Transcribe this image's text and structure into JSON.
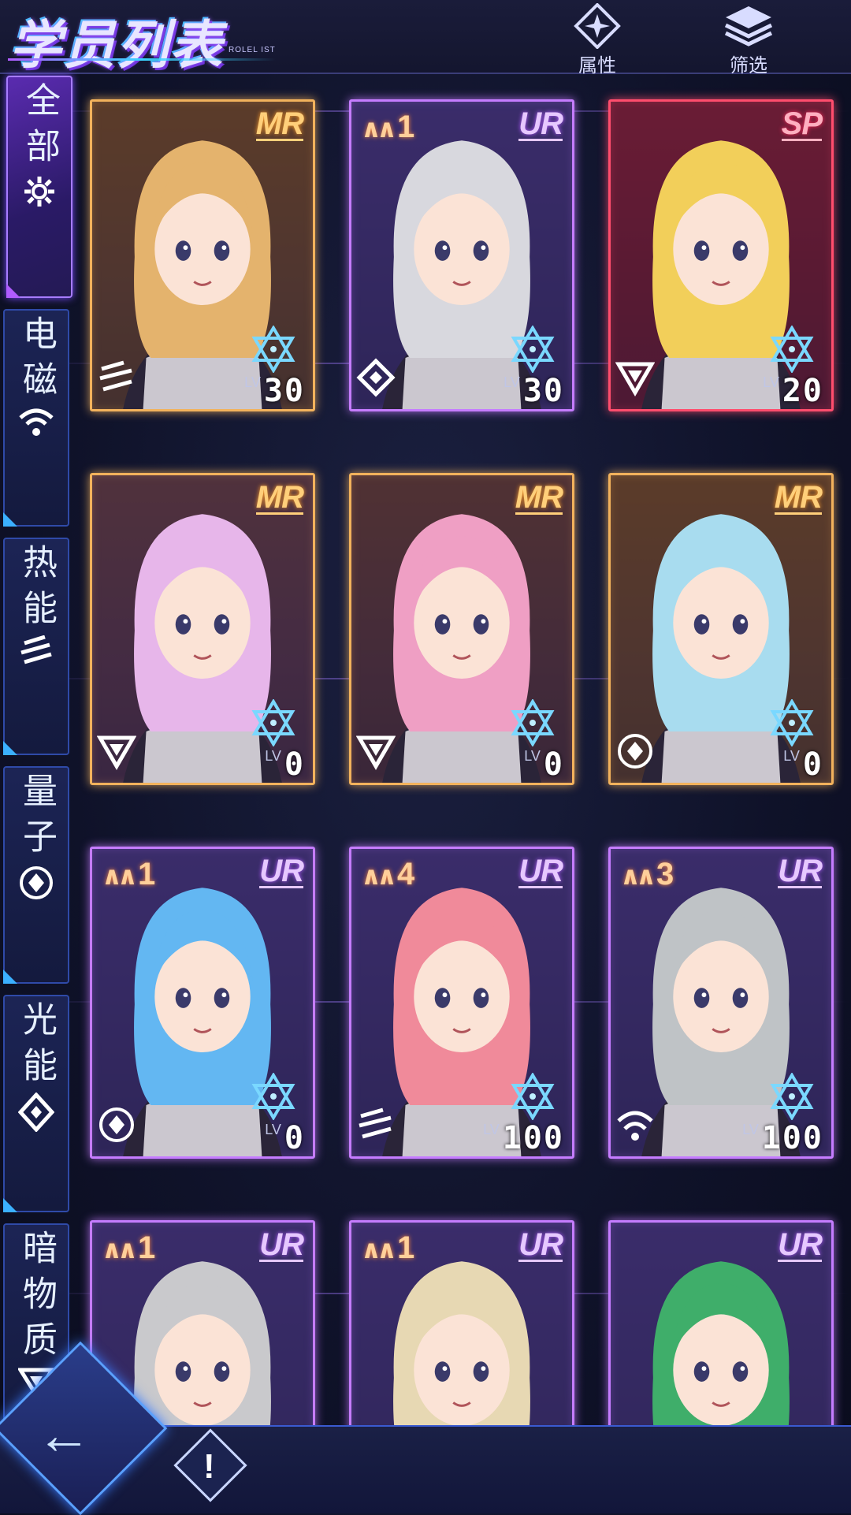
{
  "header": {
    "title": "学员列表",
    "subtitle": "ROLEL IST",
    "buttons": [
      {
        "label": "属性",
        "icon": "attribute-icon"
      },
      {
        "label": "筛选",
        "icon": "filter-layers-icon"
      }
    ]
  },
  "sidebar": {
    "tabs": [
      {
        "label": "全部",
        "icon": "all-icon",
        "active": true
      },
      {
        "label": "电磁",
        "icon": "electromagnetic-icon",
        "active": false
      },
      {
        "label": "热能",
        "icon": "thermal-icon",
        "active": false
      },
      {
        "label": "量子",
        "icon": "quantum-icon",
        "active": false
      },
      {
        "label": "光能",
        "icon": "light-icon",
        "active": false
      },
      {
        "label": "暗物质",
        "icon": "dark-matter-icon",
        "active": false
      }
    ]
  },
  "lv_label": "LV",
  "cards": [
    {
      "rarity": "MR",
      "stars": "",
      "level": "30",
      "element": "thermal",
      "hair": "#e4b36d",
      "bg": "#5b3c2a"
    },
    {
      "rarity": "UR",
      "stars": "1",
      "level": "30",
      "element": "light",
      "hair": "#d8d8de",
      "bg": "#3b2d6a"
    },
    {
      "rarity": "SP",
      "stars": "",
      "level": "20",
      "element": "dark",
      "hair": "#f2cf5a",
      "bg": "#6a1d36"
    },
    {
      "rarity": "MR",
      "stars": "",
      "level": "0",
      "element": "dark",
      "hair": "#e7b6ea",
      "bg": "#4a2b4a"
    },
    {
      "rarity": "MR",
      "stars": "",
      "level": "0",
      "element": "dark",
      "hair": "#ef9fc4",
      "bg": "#4a2b3a"
    },
    {
      "rarity": "MR",
      "stars": "",
      "level": "0",
      "element": "quantum",
      "hair": "#a8dcef",
      "bg": "#5b3c2a"
    },
    {
      "rarity": "UR",
      "stars": "1",
      "level": "0",
      "element": "quantum",
      "hair": "#63b7f2",
      "bg": "#3b2d6a"
    },
    {
      "rarity": "UR",
      "stars": "4",
      "level": "100",
      "element": "thermal",
      "hair": "#f08a9a",
      "bg": "#3b2d6a"
    },
    {
      "rarity": "UR",
      "stars": "3",
      "level": "100",
      "element": "electro",
      "hair": "#bfc3c6",
      "bg": "#3b2d6a"
    },
    {
      "rarity": "UR",
      "stars": "1",
      "level": "",
      "element": "",
      "hair": "#c9c9cc",
      "bg": "#3b2d6a"
    },
    {
      "rarity": "UR",
      "stars": "1",
      "level": "",
      "element": "",
      "hair": "#e7d8b3",
      "bg": "#3b2d6a"
    },
    {
      "rarity": "UR",
      "stars": "",
      "level": "",
      "element": "",
      "hair": "#3fae6a",
      "bg": "#3b2d6a"
    }
  ],
  "bottom": {
    "back_icon": "back-arrow-icon",
    "info_icon": "exclamation-info-icon"
  },
  "colors": {
    "MR": "#f2b25c",
    "UR": "#c57cff",
    "SP": "#ff4d6d",
    "accent": "#3bb0ff"
  }
}
